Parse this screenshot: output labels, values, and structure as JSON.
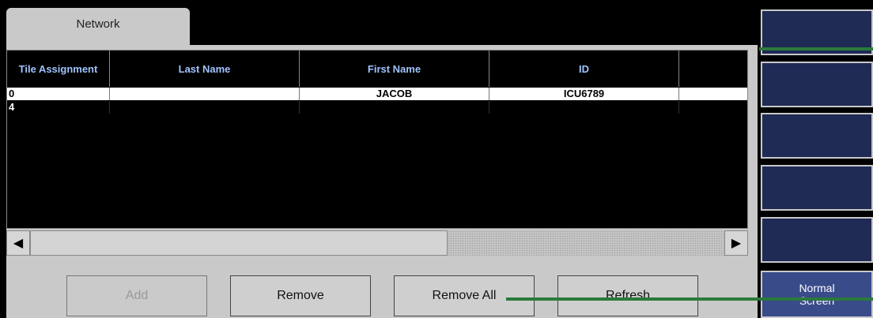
{
  "tab": {
    "label": "Network"
  },
  "table": {
    "headers": [
      "Tile Assignment",
      "Last Name",
      "First Name",
      "ID",
      ""
    ],
    "rows": [
      [
        "0",
        "",
        "JACOB",
        "ICU6789",
        ""
      ],
      [
        "4",
        "",
        "",
        "",
        ""
      ]
    ]
  },
  "scrollbar": {
    "left_arrow": "◀",
    "right_arrow": "▶"
  },
  "buttons": {
    "add": "Add",
    "remove": "Remove",
    "remove_all": "Remove All",
    "refresh": "Refresh",
    "normal_screen": "Normal",
    "normal_screen_2": "Screen"
  },
  "colors": {
    "header_text": "#9fc3ff",
    "panel_gray": "#c9c9c9",
    "side_button_blue": "#1f2a55",
    "active_side_button": "#3a4b8a"
  }
}
